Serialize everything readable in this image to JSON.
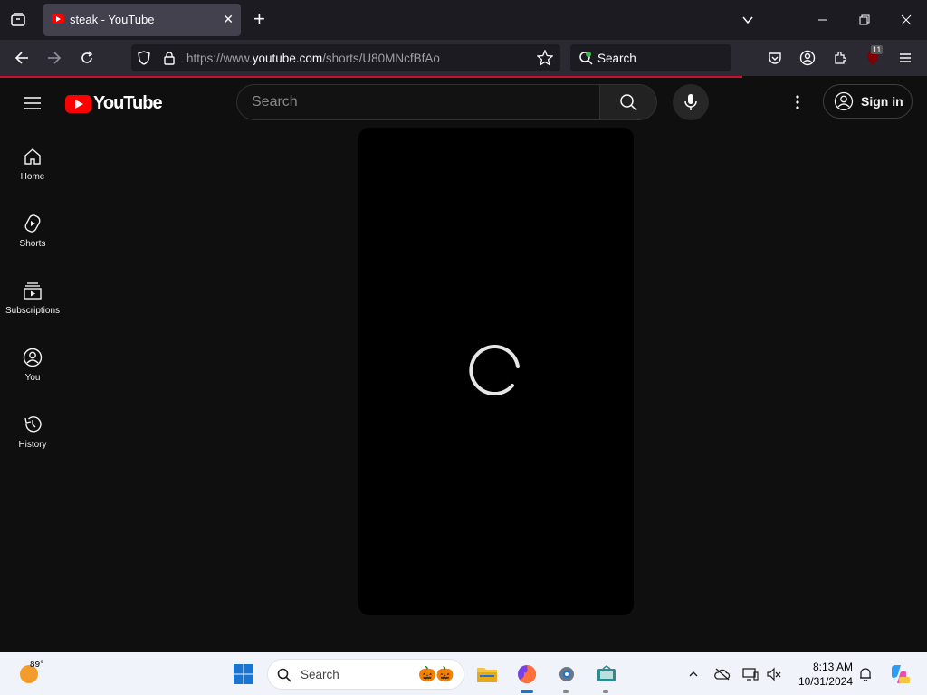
{
  "browser": {
    "tab": {
      "title": "steak - YouTube"
    },
    "url": {
      "prefix": "https://www.",
      "domain": "youtube.com",
      "path": "/shorts/U80MNcfBfAo"
    },
    "search_placeholder": "Search",
    "extension_badge": "11"
  },
  "youtube": {
    "logo_text": "YouTube",
    "search_placeholder": "Search",
    "signin_label": "Sign in",
    "sidebar": [
      {
        "label": "Home",
        "icon": "home-icon"
      },
      {
        "label": "Shorts",
        "icon": "shorts-icon"
      },
      {
        "label": "Subscriptions",
        "icon": "subscriptions-icon"
      },
      {
        "label": "You",
        "icon": "you-icon"
      },
      {
        "label": "History",
        "icon": "history-icon"
      }
    ]
  },
  "taskbar": {
    "weather_temp": "89°",
    "search_label": "Search",
    "time": "8:13 AM",
    "date": "10/31/2024"
  },
  "colors": {
    "accent_red": "#ff0000",
    "browser_bg": "#1c1b22",
    "page_bg": "#0f0f0f"
  }
}
